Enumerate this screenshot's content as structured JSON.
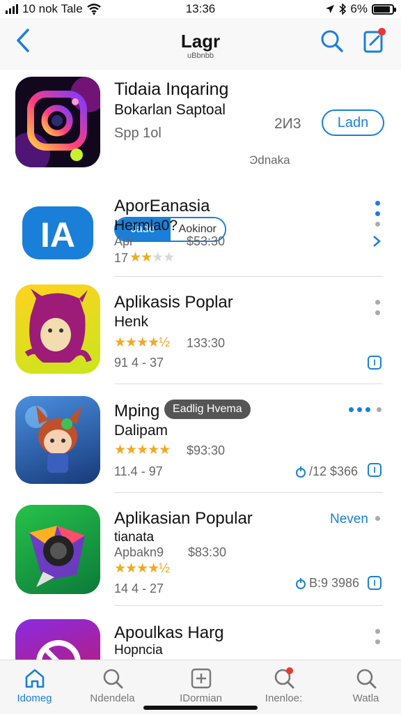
{
  "status": {
    "carrier": "10 nok Tale",
    "time": "13:36",
    "battery": "6%"
  },
  "nav": {
    "title": "Lagr",
    "subtitle": "uBbnbb"
  },
  "featured": {
    "name": "Tidaia Inqaring",
    "sub": "Bokarlan Saptoal",
    "meta": "Spp 1ol",
    "count": "2И3",
    "action": "Ladn",
    "seg_on": "Jade",
    "seg_off": "Aokinor",
    "extra": "Ͽdnaka"
  },
  "apps": [
    {
      "name": "AporEanasia",
      "sub": "Hermla0?",
      "meta1": "Apr",
      "price": "$53:30",
      "meta2": "17",
      "stars": 2
    },
    {
      "name": "Aplikasis Poplar",
      "sub": "Henk",
      "price": "133:30",
      "meta2": "91 4 - 37",
      "stars": 4.5
    },
    {
      "name": "Mping",
      "tag": "Eadlig Hvema",
      "sub": "Dalipam",
      "price": "$93:30",
      "meta2": "11.4 - 97",
      "right": "/12 $366",
      "stars": 5
    },
    {
      "name": "Aplikasian Popular",
      "sub": "tianata",
      "meta1": "Apbakn9",
      "price": "$83:30",
      "meta2": "14 4 - 27",
      "right": "B:9 3986",
      "action": "Neven",
      "stars": 4.5
    },
    {
      "name": "Apoulkas Harg",
      "sub": "Hopncia"
    }
  ],
  "tabs": [
    {
      "label": "Idomeg"
    },
    {
      "label": "Ndendela"
    },
    {
      "label": "IDormian"
    },
    {
      "label": "Inenloe:"
    },
    {
      "label": "Watla"
    }
  ],
  "info_glyph": "I"
}
